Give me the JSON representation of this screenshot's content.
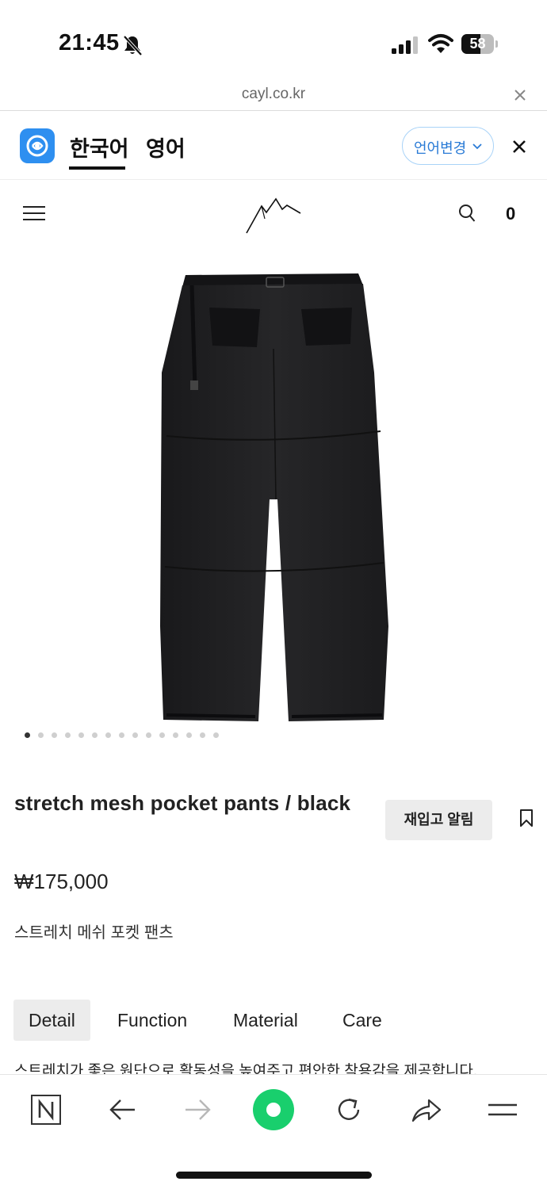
{
  "status_bar": {
    "time": "21:45",
    "battery_level": "58",
    "battery_fraction": 0.58,
    "icons": [
      "bell-slash-icon",
      "signal-icon",
      "wifi-icon",
      "battery-icon"
    ]
  },
  "browser": {
    "url": "cayl.co.kr"
  },
  "translate_bar": {
    "lang_tabs": [
      {
        "label": "한국어",
        "active": true
      },
      {
        "label": "영어",
        "active": false
      }
    ],
    "change_language_label": "언어변경"
  },
  "site_header": {
    "cart_count": "0",
    "icons": [
      "hamburger-menu-icon",
      "mountain-logo",
      "search-icon"
    ]
  },
  "carousel": {
    "total_images": 15,
    "active_index": 0
  },
  "product": {
    "title": "stretch mesh pocket pants / black",
    "price": "₩175,000",
    "korean_name": "스트레치 메쉬 포켓 팬츠",
    "restock_label": "재입고 알림"
  },
  "detail_tabs": {
    "tabs": [
      {
        "label": "Detail",
        "active": true
      },
      {
        "label": "Function",
        "active": false
      },
      {
        "label": "Material",
        "active": false
      },
      {
        "label": "Care",
        "active": false
      }
    ],
    "content": "스트레치가 좋은 원단으로 활동성을 높여주고 편안한 착용감을 제공합니다."
  },
  "colors": {
    "accent_blue": "#2e8ff0",
    "naver_green": "#19cf6d",
    "product_black": "#1f1f21"
  }
}
